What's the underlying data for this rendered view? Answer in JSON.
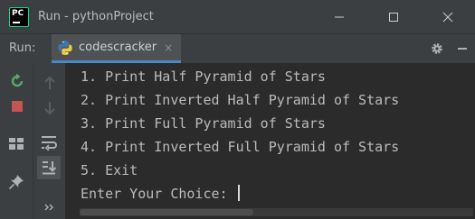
{
  "window": {
    "title": "Run - pythonProject",
    "app_icon_text": "PC",
    "controls": [
      "minimize-icon",
      "maximize-icon",
      "close-icon"
    ]
  },
  "run_panel": {
    "label": "Run:",
    "tab": {
      "label": "codescracker",
      "close": "×",
      "icon": "python-icon"
    },
    "tools": [
      "gear-icon",
      "hide-icon"
    ]
  },
  "left_toolbar": [
    "rerun-icon",
    "stop-icon",
    "layout-icon",
    "pin-icon"
  ],
  "console_toolbar": [
    "up-arrow-icon",
    "down-arrow-icon",
    "soft-wrap-icon",
    "scroll-to-end-icon",
    "more-icon"
  ],
  "console": {
    "lines": [
      "1. Print Half Pyramid of Stars",
      "2. Print Inverted Half Pyramid of Stars",
      "3. Print Full Pyramid of Stars",
      "4. Print Inverted Full Pyramid of Stars",
      "5. Exit",
      "Enter Your Choice: "
    ]
  },
  "colors": {
    "background": "#2b2b2b",
    "panel": "#3c3f41",
    "text": "#bbbbbb",
    "accent": "#4a88c7",
    "rerun": "#59a869",
    "stop": "#c75450"
  }
}
